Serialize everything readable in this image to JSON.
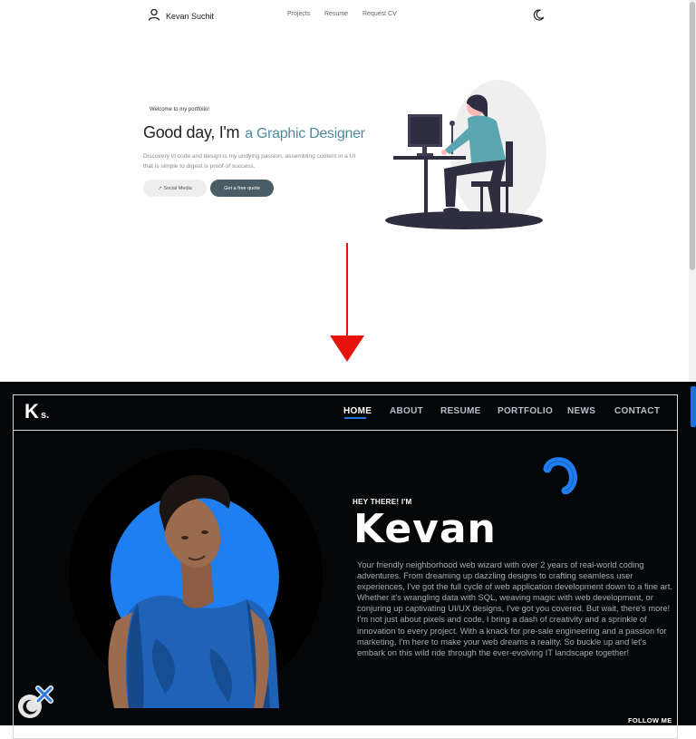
{
  "before": {
    "brand": {
      "name": "Kevan Suchit",
      "icon": "user-icon"
    },
    "nav": [
      {
        "label": "Projects"
      },
      {
        "label": "Resume"
      },
      {
        "label": "Request CV"
      }
    ],
    "theme_icon": "moon-icon",
    "hero": {
      "welcome": "Welcome to my portfolio!",
      "greeting": "Good day, I'm",
      "role": "a Graphic Designer",
      "description": "Discovery in code and design is my undying passion, assembling content in a UI that is simple to digest is proof of success.",
      "social_button": "↗ Social Media",
      "quote_button": "Get a free quote"
    },
    "colors": {
      "accent": "#4c8a9e",
      "button_dark": "#4a5d66"
    }
  },
  "transition_arrow_color": "#e8120c",
  "after": {
    "logo": {
      "letter": "K",
      "suffix": "s."
    },
    "nav": [
      {
        "label": "HOME"
      },
      {
        "label": "ABOUT"
      },
      {
        "label": "RESUME"
      },
      {
        "label": "PORTFOLIO"
      },
      {
        "label": "NEWS"
      },
      {
        "label": "CONTACT"
      }
    ],
    "active_nav": "HOME",
    "hero": {
      "eyebrow": "HEY THERE! I'M",
      "name": "Kevan",
      "bio": "Your friendly neighborhood web wizard with over 2 years of real-world coding adventures. From dreaming up dazzling designs to crafting seamless user experiences, I've got the full cycle of web application development down to a fine art. Whether it's wrangling data with SQL, weaving magic with web development, or conjuring up captivating UI/UX designs, I've got you covered. But wait, there's more! I'm not just about pixels and code, I bring a dash of creativity and a sprinkle of innovation to every project. With a knack for pre-sale engineering and a passion for marketing, I'm here to make your web dreams a reality. So buckle up and let's embark on this wild ride through the ever-evolving IT landscape together!",
      "follow": "FOLLOW ME"
    },
    "floating": {
      "theme_icon": "moon-icon",
      "close_icon": "close-icon"
    },
    "colors": {
      "background": "#050608",
      "accent": "#1f7ff0",
      "text": "#ffffff",
      "muted": "#a7adb5"
    }
  }
}
